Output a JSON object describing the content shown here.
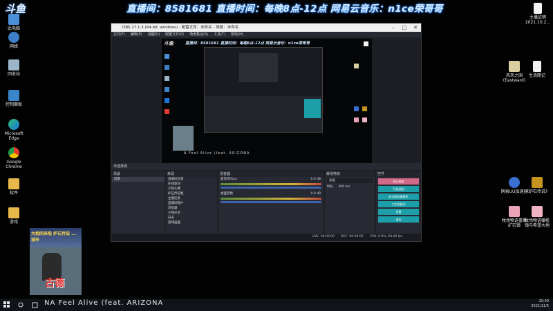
{
  "banner": "直播间：8581681 直播时间：每晚8点-12点 网易云音乐：n1ce荣哥哥",
  "brand": "斗鱼",
  "desktop_icons_left": [
    {
      "label": "此电脑",
      "icon": "computer-icon"
    },
    {
      "label": "网络",
      "icon": "network-icon"
    },
    {
      "label": "回收站",
      "icon": "recycle-bin-icon"
    },
    {
      "label": "控制面板",
      "icon": "control-panel-icon"
    },
    {
      "label": "Microsoft Edge",
      "icon": "edge-icon"
    },
    {
      "label": "Google Chrome",
      "icon": "chrome-icon"
    },
    {
      "label": "软件",
      "icon": "folder-icon"
    },
    {
      "label": "游戏",
      "icon": "folder-icon"
    }
  ],
  "desktop_icons_right": [
    {
      "label": "风来之国 (Eastward)",
      "icon": "game-icon"
    },
    {
      "label": "生活随记",
      "icon": "document-icon"
    },
    {
      "label": "网易UU加速器",
      "icon": "uu-icon"
    },
    {
      "label": "《炉石传说》",
      "icon": "hearthstone-icon"
    },
    {
      "label": "牧场物语重聚 矿石镇",
      "icon": "farm-icon"
    },
    {
      "label": "牧场物语橄榄 镇与希望大地",
      "icon": "farm-icon"
    }
  ],
  "top_right_file": {
    "label": "主播证明",
    "date": "2021.10.2..."
  },
  "obs": {
    "title": "OBS 27.1.3 (64-bit, windows) - 配置文件：未命名 - 场景：未命名",
    "menu": [
      "文件(F)",
      "编辑(E)",
      "视图(V)",
      "配置文件(P)",
      "场景集合(S)",
      "工具(T)",
      "帮助(H)"
    ],
    "preview_banner": "直播间：8581681 直播时间：每晚8点-12点 网易云音乐：n1ce荣哥哥",
    "preview_logo": "斗鱼",
    "preview_song": "A Feel Alive (feat. ARIZONA",
    "selected_source": "未选择源",
    "docks": {
      "scenes": "场景",
      "sources": "来源",
      "mixer": "混音器",
      "transitions": "转场特效",
      "controls": "控件"
    },
    "scene_items": [
      "场景"
    ],
    "source_items": [
      "直播间信息",
      "在线歌词",
      "小熊头像",
      "炉石传说框",
      "主播信息",
      "直播间图片",
      "浏览器",
      "小熊声音",
      "白天",
      "游戏画面"
    ],
    "mixer_channels": [
      {
        "name": "麦克风/Aux",
        "db": "0.0 dB"
      },
      {
        "name": "桌面音频",
        "db": "0.0 dB"
      }
    ],
    "transition": {
      "type": "淡出",
      "duration_label": "时长",
      "duration": "300 ms"
    },
    "controls": [
      "停止推流",
      "开始录制",
      "启动虚拟摄像机",
      "工作室模式",
      "设置",
      "退出"
    ],
    "status": {
      "live": "LIVE: 00:00:00",
      "rec": "REC: 00:00:00",
      "cpu": "CPU: 0.9%, 60.00 fps"
    }
  },
  "streamer": {
    "name": "古德",
    "headline": "大炮回来啦 炉石传说 ... 城市"
  },
  "taskbar": {
    "song": "NA Feel Alive (feat. ARIZONA",
    "time": "20:00",
    "date": "2021/11/5"
  }
}
